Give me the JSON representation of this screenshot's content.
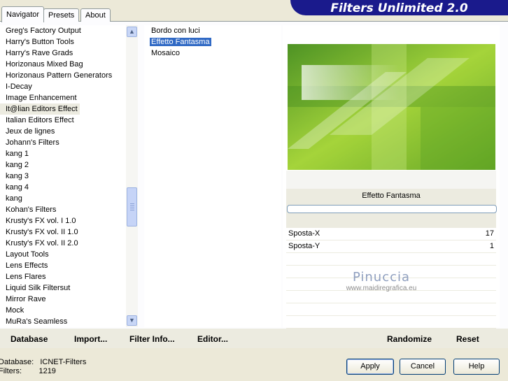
{
  "banner": {
    "title": "Filters Unlimited 2.0"
  },
  "tabs": [
    {
      "label": "Navigator",
      "active": true
    },
    {
      "label": "Presets",
      "active": false
    },
    {
      "label": "About",
      "active": false
    }
  ],
  "categories": {
    "items": [
      "Greg's Factory Output",
      "Harry's Button Tools",
      "Harry's Rave Grads",
      "Horizonaus Mixed Bag",
      "Horizonaus Pattern Generators",
      "I-Decay",
      "Image Enhancement",
      "It@lian Editors Effect",
      "Italian Editors Effect",
      "Jeux de lignes",
      "Johann's Filters",
      "kang 1",
      "kang 2",
      "kang 3",
      "kang 4",
      "kang",
      "Kohan's Filters",
      "Krusty's FX vol. I 1.0",
      "Krusty's FX vol. II 1.0",
      "Krusty's FX vol. II 2.0",
      "Layout Tools",
      "Lens Effects",
      "Lens Flares",
      "Liquid Silk Filtersut",
      "Mirror Rave",
      "Mock",
      "MuRa's Seamless"
    ],
    "selected": "It@lian Editors Effect"
  },
  "filters": {
    "items": [
      "Bordo con luci",
      "Effetto Fantasma",
      "Mosaico"
    ],
    "selected": "Effetto Fantasma"
  },
  "preview": {
    "filter_name": "Effetto Fantasma",
    "progress": 0
  },
  "controls": [
    {
      "label": "Sposta-X",
      "value": "17"
    },
    {
      "label": "Sposta-Y",
      "value": "1"
    }
  ],
  "watermark": {
    "title": "Pinuccia",
    "url": "www.maidiregrafica.eu"
  },
  "links": {
    "database": "Database",
    "import": "Import...",
    "filter_info": "Filter Info...",
    "editor": "Editor...",
    "randomize": "Randomize",
    "reset": "Reset"
  },
  "status": {
    "database_label": "Database:",
    "database_value": "ICNET-Filters",
    "filters_label": "Filters:",
    "filters_value": "1219"
  },
  "buttons": {
    "apply": "Apply",
    "cancel": "Cancel",
    "help": "Help"
  },
  "colors": {
    "banner": "#1a1a8c",
    "selection": "#316ac5",
    "preview_green": "#7cbf1e"
  }
}
